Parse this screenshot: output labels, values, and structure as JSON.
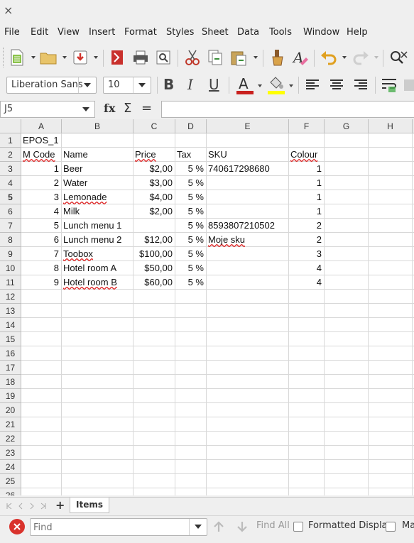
{
  "window": {
    "close_glyph": "×"
  },
  "menu": [
    "File",
    "Edit",
    "View",
    "Insert",
    "Format",
    "Styles",
    "Sheet",
    "Data",
    "Tools",
    "Window",
    "Help"
  ],
  "toolbar": {
    "font_name": "Liberation Sans",
    "font_size": "10",
    "bold": "B",
    "italic": "I",
    "underline": "U",
    "font_color_glyph": "A",
    "font_color_hex": "#c9211e",
    "highlight_hex": "#ffff00"
  },
  "formula_bar": {
    "cell_ref": "J5",
    "fx": "fx",
    "sigma": "Σ",
    "equals": "=",
    "content": ""
  },
  "sheet": {
    "columns": [
      "A",
      "B",
      "C",
      "D",
      "E",
      "F",
      "G",
      "H"
    ],
    "rows": [
      "1",
      "2",
      "3",
      "4",
      "5",
      "6",
      "7",
      "8",
      "9",
      "10",
      "11",
      "12",
      "13",
      "14",
      "15",
      "16",
      "17",
      "18",
      "19",
      "20",
      "21",
      "22",
      "23",
      "24",
      "25",
      "26"
    ],
    "selected_row": "5",
    "title_cell": "EPOS_1",
    "headers": {
      "mcode": "M Code",
      "name": "Name",
      "price": "Price",
      "tax": "Tax",
      "sku": "SKU",
      "colour": "Colour"
    },
    "items": [
      {
        "code": "1",
        "name": "Beer",
        "price": "$2,00",
        "tax": "5 %",
        "sku": "740617298680",
        "colour": "1"
      },
      {
        "code": "2",
        "name": "Water",
        "price": "$3,00",
        "tax": "5 %",
        "sku": "",
        "colour": "1"
      },
      {
        "code": "3",
        "name": "Lemonade",
        "price": "$4,00",
        "tax": "5 %",
        "sku": "",
        "colour": "1"
      },
      {
        "code": "4",
        "name": "Milk",
        "price": "$2,00",
        "tax": "5 %",
        "sku": "",
        "colour": "1"
      },
      {
        "code": "5",
        "name": "Lunch menu 1",
        "price": "",
        "tax": "5 %",
        "sku": "8593807210502",
        "colour": "2"
      },
      {
        "code": "6",
        "name": "Lunch menu 2",
        "price": "$12,00",
        "tax": "5 %",
        "sku": "Moje sku",
        "colour": "2"
      },
      {
        "code": "7",
        "name": "Toobox",
        "price": "$100,00",
        "tax": "5 %",
        "sku": "",
        "colour": "3"
      },
      {
        "code": "8",
        "name": "Hotel room A",
        "price": "$50,00",
        "tax": "5 %",
        "sku": "",
        "colour": "4"
      },
      {
        "code": "9",
        "name": "Hotel room B",
        "price": "$60,00",
        "tax": "5 %",
        "sku": "",
        "colour": "4"
      }
    ]
  },
  "sheet_tabs": {
    "add_glyph": "+",
    "active_tab": "Items"
  },
  "find_bar": {
    "placeholder": "Find",
    "find_all": "Find All",
    "formatted_display": "Formatted Display",
    "match_case_partial": "Ma"
  }
}
